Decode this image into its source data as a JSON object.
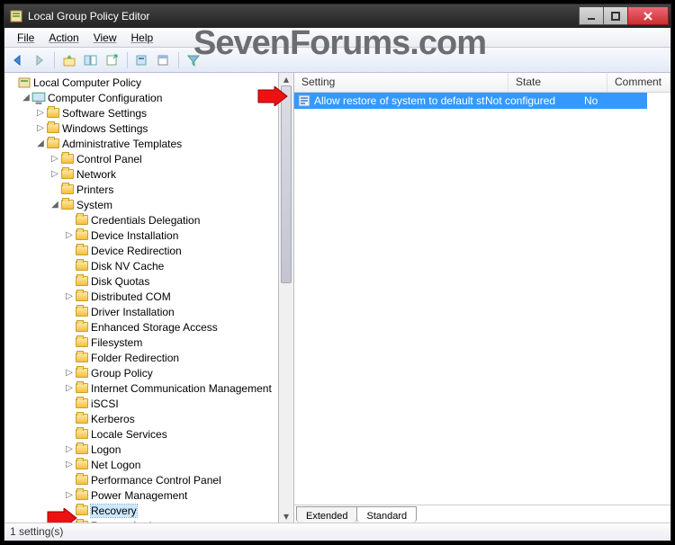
{
  "window": {
    "title": "Local Group Policy Editor"
  },
  "menu": {
    "file": "File",
    "action": "Action",
    "view": "View",
    "help": "Help"
  },
  "watermark": "SevenForums.com",
  "tree": {
    "root": "Local Computer Policy",
    "cc": "Computer Configuration",
    "sws": "Software Settings",
    "wns": "Windows Settings",
    "adm": "Administrative Templates",
    "cp": "Control Panel",
    "net": "Network",
    "prn": "Printers",
    "sys": "System",
    "items": [
      "Credentials Delegation",
      "Device Installation",
      "Device Redirection",
      "Disk NV Cache",
      "Disk Quotas",
      "Distributed COM",
      "Driver Installation",
      "Enhanced Storage Access",
      "Filesystem",
      "Folder Redirection",
      "Group Policy",
      "Internet Communication Management",
      "iSCSI",
      "Kerberos",
      "Locale Services",
      "Logon",
      "Net Logon",
      "Performance Control Panel",
      "Power Management",
      "Recovery",
      "Remote Assistance"
    ]
  },
  "list": {
    "cols": {
      "setting": "Setting",
      "state": "State",
      "comment": "Comment"
    },
    "row": {
      "setting": "Allow restore of system to default state",
      "state": "Not configured",
      "comment": "No"
    }
  },
  "tabs": {
    "extended": "Extended",
    "standard": "Standard"
  },
  "status": "1 setting(s)"
}
